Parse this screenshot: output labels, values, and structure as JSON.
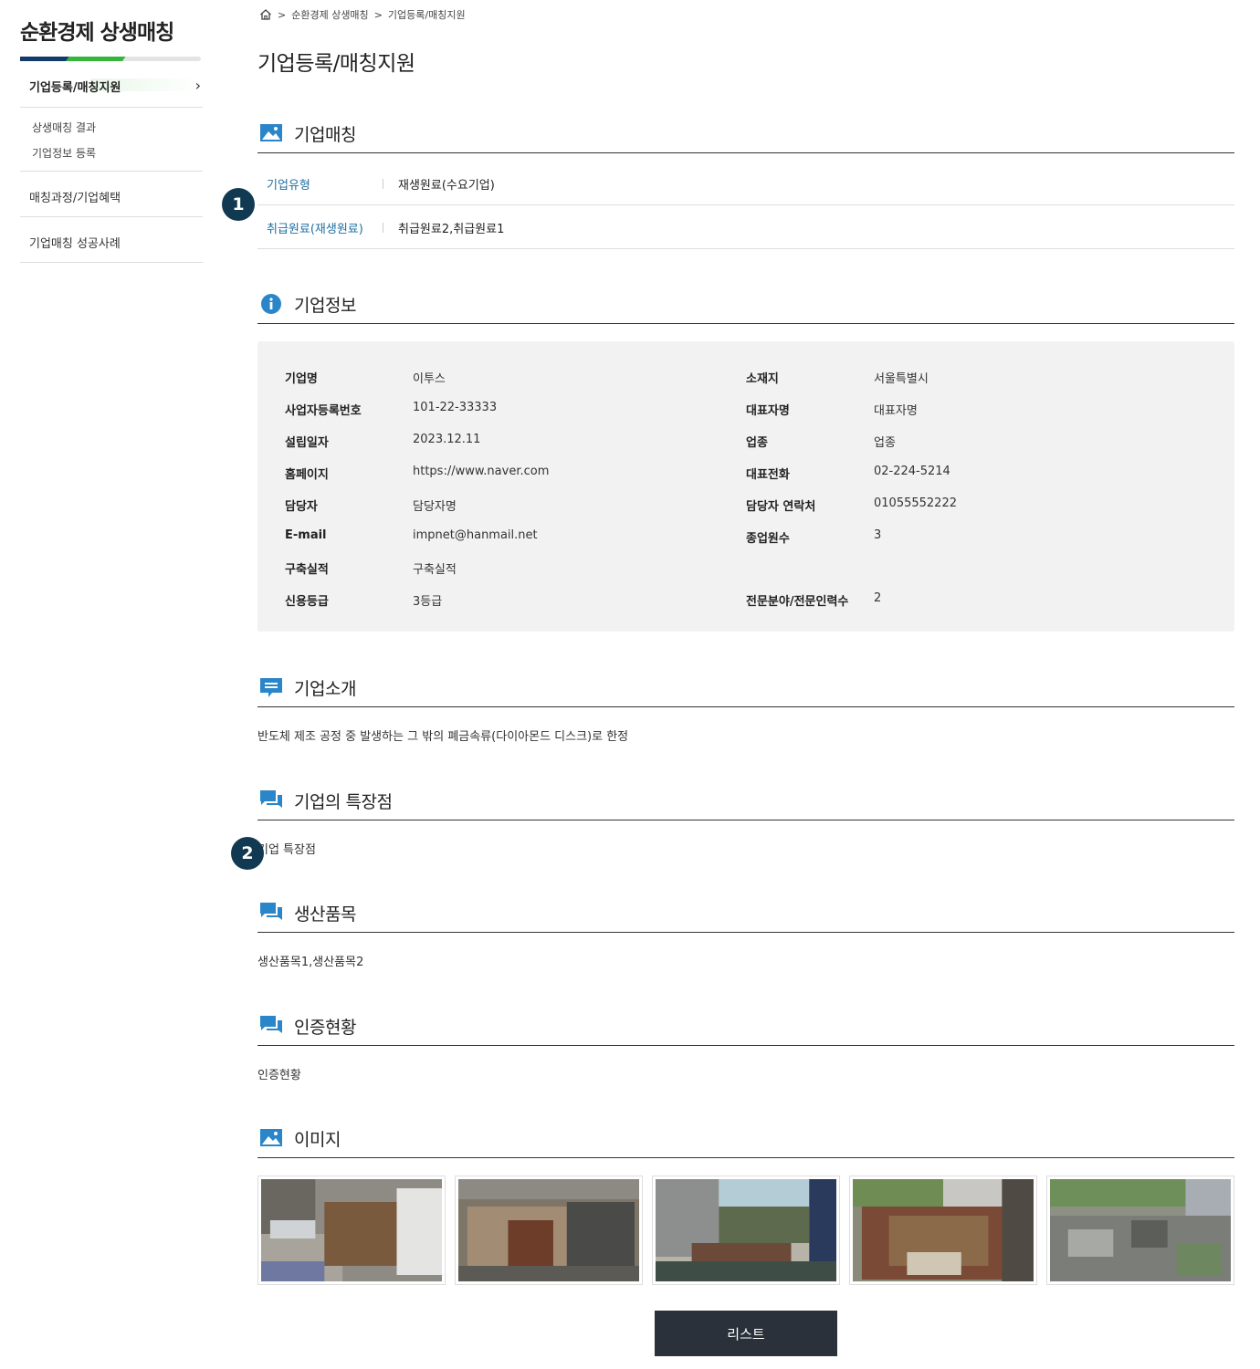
{
  "sidebar": {
    "title": "순환경제 상생매칭",
    "active_item": "기업등록/매칭지원",
    "sub_items": [
      "상생매칭 결과",
      "기업정보 등록"
    ],
    "items": [
      "매칭과정/기업혜택",
      "기업매칭 성공사례"
    ]
  },
  "breadcrumb": {
    "sep": ">",
    "level1": "순환경제 상생매칭",
    "level2": "기업등록/매칭지원"
  },
  "page_title": "기업등록/매칭지원",
  "sections": {
    "matching": "기업매칭",
    "info": "기업정보",
    "intro": "기업소개",
    "features": "기업의 특장점",
    "products": "생산품목",
    "certification": "인증현황",
    "images": "이미지"
  },
  "matching": {
    "type_label": "기업유형",
    "type_value": "재생원료(수요기업)",
    "material_label": "취급원료(재생원료)",
    "material_value": "취급원료2,취급원료1"
  },
  "info": {
    "company_name_label": "기업명",
    "company_name": "이투스",
    "location_label": "소재지",
    "location": "서울특별시",
    "bizno_label": "사업자등록번호",
    "bizno": "101-22-33333",
    "ceo_label": "대표자명",
    "ceo": "대표자명",
    "founded_label": "설립일자",
    "founded": "2023.12.11",
    "industry_label": "업종",
    "industry": "업종",
    "homepage_label": "홈페이지",
    "homepage": "https://www.naver.com",
    "phone_label": "대표전화",
    "phone": "02-224-5214",
    "manager_label": "담당자",
    "manager": "담당자명",
    "manager_phone_label": "담당자 연락처",
    "manager_phone": "01055552222",
    "email_label": "E-mail",
    "email": "impnet@hanmail.net",
    "employees_label": "종업원수",
    "employees": "3",
    "record_label": "구축실적",
    "record": "구축실적",
    "credit_label": "신용등급",
    "credit": "3등급",
    "experts_label": "전문분야/전문인력수",
    "experts": "2"
  },
  "intro_text": "반도체 제조 공정 중 발생하는 그 밖의 폐금속류(다이아몬드 디스크)로 한정",
  "features_text": "기업 특장점",
  "products_text": "생산품목1,생산품목2",
  "certification_text": "인증현황",
  "badges": {
    "one": "1",
    "two": "2"
  },
  "list_button": "리스트",
  "colors": {
    "accent_blue": "#1f6fa0",
    "icon_blue": "#2a86c8",
    "badge": "#113a52",
    "button": "#2b313a",
    "bar_green": "#36b43b",
    "bar_navy": "#123a6b"
  }
}
